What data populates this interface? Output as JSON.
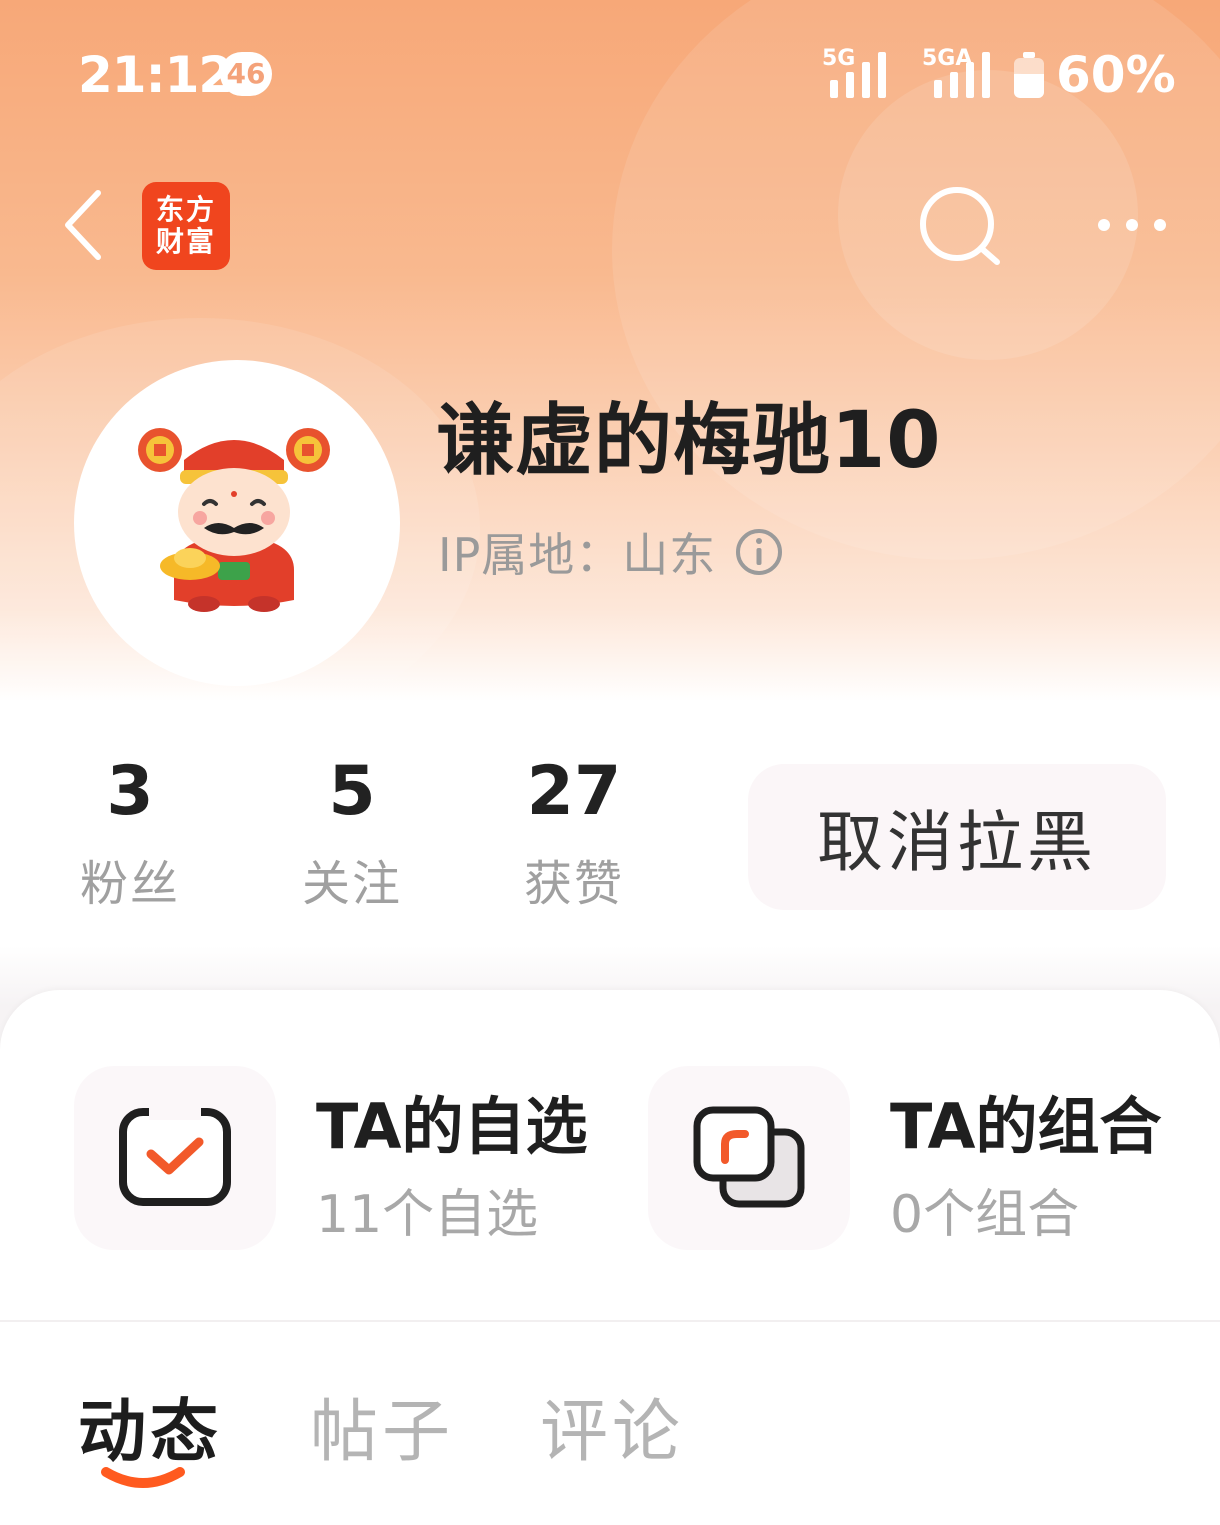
{
  "status_bar": {
    "time": "21:12",
    "network_badge": "46",
    "signal1_label": "5G",
    "signal2_label": "5GA",
    "battery": "60%"
  },
  "nav": {
    "logo_line1": "东方",
    "logo_line2": "财富"
  },
  "profile": {
    "username": "谦虚的梅驰10",
    "ip_location": "IP属地：山东"
  },
  "stats": [
    {
      "value": "3",
      "label": "粉丝"
    },
    {
      "value": "5",
      "label": "关注"
    },
    {
      "value": "27",
      "label": "获赞"
    }
  ],
  "unblock_button": "取消拉黑",
  "features": [
    {
      "title": "TA的自选",
      "subtitle": "11个自选"
    },
    {
      "title": "TA的组合",
      "subtitle": "0个组合"
    }
  ],
  "tabs": [
    {
      "label": "动态",
      "active": true
    },
    {
      "label": "帖子",
      "active": false
    },
    {
      "label": "评论",
      "active": false
    }
  ],
  "colors": {
    "brand": "#f0451e",
    "accent": "#ff5a1f",
    "header_gradient_top": "#f7a878"
  }
}
